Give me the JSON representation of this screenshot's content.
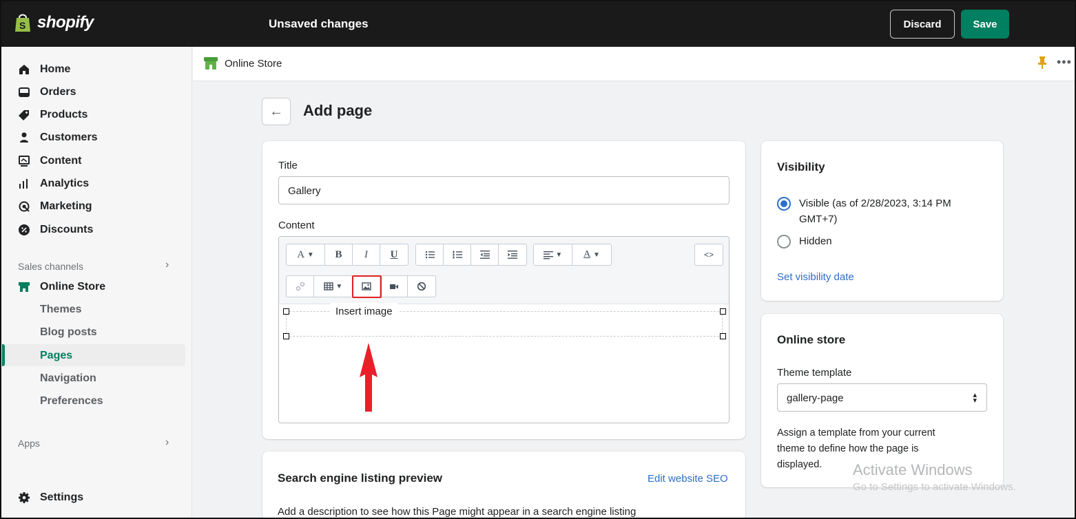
{
  "topbar": {
    "logo_text": "shopify",
    "status": "Unsaved changes",
    "discard_label": "Discard",
    "save_label": "Save"
  },
  "sidebar": {
    "items": [
      {
        "label": "Home",
        "icon": "home-icon"
      },
      {
        "label": "Orders",
        "icon": "orders-icon"
      },
      {
        "label": "Products",
        "icon": "tag-icon"
      },
      {
        "label": "Customers",
        "icon": "person-icon"
      },
      {
        "label": "Content",
        "icon": "content-icon"
      },
      {
        "label": "Analytics",
        "icon": "bar-chart-icon"
      },
      {
        "label": "Marketing",
        "icon": "target-icon"
      },
      {
        "label": "Discounts",
        "icon": "discount-icon"
      }
    ],
    "sales_channels_label": "Sales channels",
    "online_store_label": "Online Store",
    "sub_items": [
      "Themes",
      "Blog posts",
      "Pages",
      "Navigation",
      "Preferences"
    ],
    "apps_label": "Apps",
    "settings_label": "Settings"
  },
  "header": {
    "store_label": "Online Store"
  },
  "page": {
    "title": "Add page",
    "title_label": "Title",
    "title_value": "Gallery",
    "content_label": "Content",
    "tooltip": "Insert image",
    "toolbar": {
      "font_btn": "A",
      "bold": "B",
      "italic": "I",
      "underline": "U",
      "color_btn": "A",
      "html_btn": "<>"
    }
  },
  "seo": {
    "heading": "Search engine listing preview",
    "edit_link": "Edit website SEO",
    "description": "Add a description to see how this Page might appear in a search engine listing"
  },
  "visibility": {
    "heading": "Visibility",
    "visible_label": "Visible (as of 2/28/2023, 3:14 PM",
    "visible_label_2": "GMT+7)",
    "hidden_label": "Hidden",
    "set_date_link": "Set visibility date"
  },
  "online_store": {
    "heading": "Online store",
    "template_label": "Theme template",
    "template_value": "gallery-page",
    "help_line1": "Assign a template from your current",
    "help_line2": "theme to define how the page is",
    "help_line3": "displayed."
  },
  "watermark": {
    "line1": "Activate Windows",
    "line2": "Go to Settings to activate Windows."
  },
  "colors": {
    "accent_green": "#008060",
    "link_blue": "#2c6ecb",
    "highlight_red": "#e02020"
  }
}
